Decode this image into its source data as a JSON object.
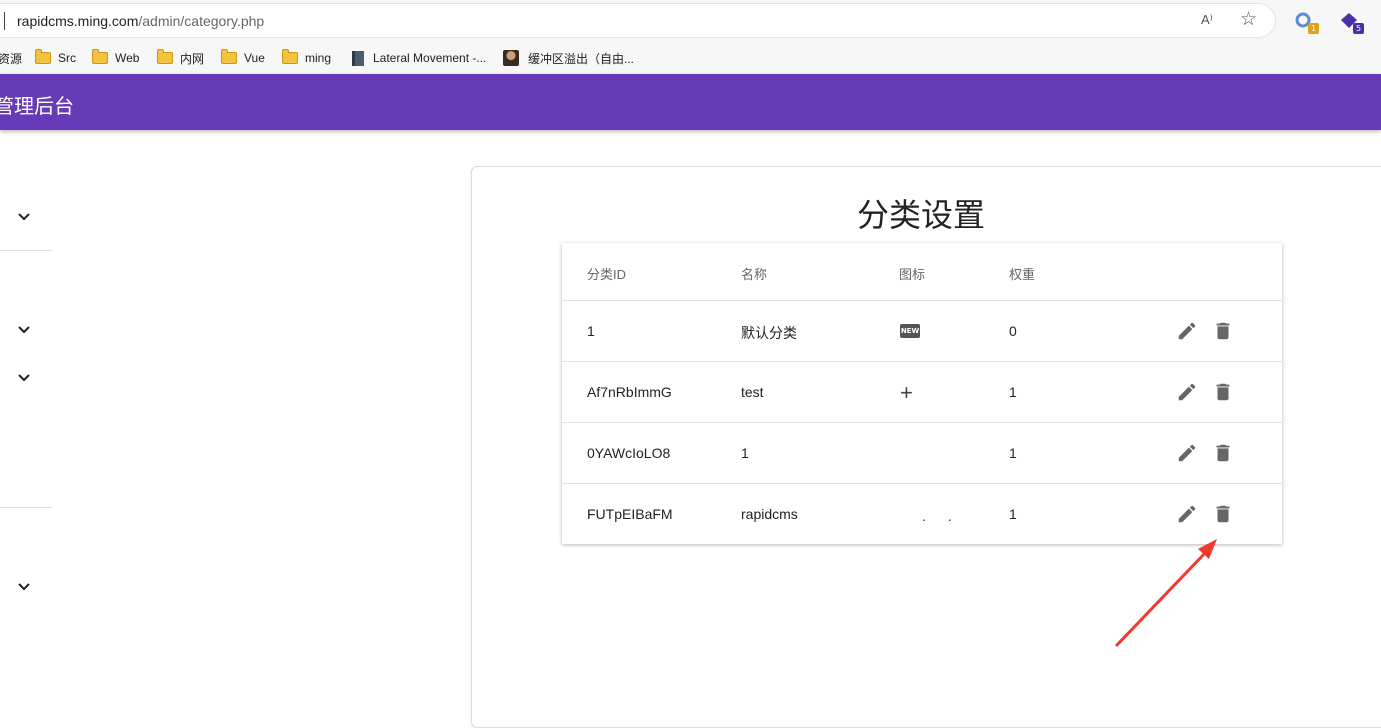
{
  "browser": {
    "url_host": "rapidcms.ming.com",
    "url_path": "/admin/category.php",
    "read_aloud_label": "A⁾",
    "extensions": [
      {
        "name": "extension-1",
        "badge": "1",
        "color": "#5b8dd6",
        "badge_color": "#e0a21a"
      },
      {
        "name": "extension-2",
        "badge": "5",
        "color": "#4b2fa8",
        "badge_color": "#4b2fa8"
      }
    ]
  },
  "bookmarks": [
    {
      "label": "资源",
      "icon": "folder-icon"
    },
    {
      "label": "Src",
      "icon": "folder-icon"
    },
    {
      "label": "Web",
      "icon": "folder-icon"
    },
    {
      "label": "内网",
      "icon": "folder-icon"
    },
    {
      "label": "Vue",
      "icon": "folder-icon"
    },
    {
      "label": "ming",
      "icon": "folder-icon"
    },
    {
      "label": "Lateral Movement -...",
      "icon": "book-icon"
    },
    {
      "label": "缓冲区溢出（自由...",
      "icon": "image-icon"
    }
  ],
  "appbar": {
    "title": "管理后台",
    "color": "#673ab7"
  },
  "main": {
    "title": "分类设置",
    "table": {
      "headers": [
        "分类ID",
        "名称",
        "图标",
        "权重"
      ],
      "rows": [
        {
          "id": "1",
          "name": "默认分类",
          "icon": "new-badge-icon",
          "icon_text": "NEW",
          "weight": "0"
        },
        {
          "id": "Af7nRbImmG",
          "name": "test",
          "icon": "plus-icon",
          "icon_text": "+",
          "weight": "1"
        },
        {
          "id": "0YAWcIoLO8",
          "name": "1",
          "icon": "none",
          "icon_text": "",
          "weight": "1"
        },
        {
          "id": "FUTpEIBaFM",
          "name": "rapidcms",
          "icon": "dots-icon",
          "icon_text": "..",
          "weight": "1"
        }
      ]
    }
  },
  "colors": {
    "accent": "#673ab7",
    "annotation_arrow": "#f03a2e"
  }
}
